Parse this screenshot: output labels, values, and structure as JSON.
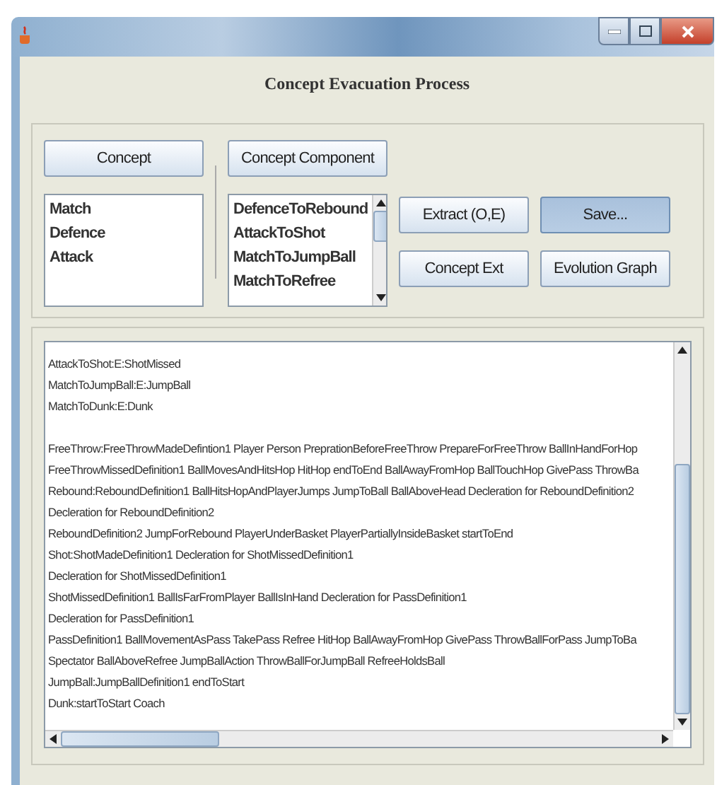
{
  "heading": "Concept Evacuation Process",
  "concept_panel": {
    "button": "Concept",
    "items": [
      "Match",
      "Defence",
      "Attack"
    ]
  },
  "component_panel": {
    "button": "Concept Component",
    "items": [
      "DefenceToRebound",
      "AttackToShot",
      "MatchToJumpBall",
      "MatchToRefree"
    ]
  },
  "actions": [
    {
      "label": "Extract (O,E)",
      "selected": false
    },
    {
      "label": "Save...",
      "selected": true
    },
    {
      "label": "Concept Ext",
      "selected": false
    },
    {
      "label": "Evolution Graph",
      "selected": false
    }
  ],
  "output": {
    "paragraphs": [
      [
        "AttackToShot:E:ShotMissed",
        "MatchToJumpBall:E:JumpBall",
        "MatchToDunk:E:Dunk"
      ],
      [
        "FreeThrow:FreeThrowMadeDefintion1 Player Person PreprationBeforeFreeThrow PrepareForFreeThrow BallInHandForHop",
        "FreeThrowMissedDefinition1 BallMovesAndHitsHop HitHop endToEnd BallAwayFromHop BallTouchHop GivePass ThrowBa",
        "Rebound:ReboundDefinition1 BallHitsHopAndPlayerJumps JumpToBall BallAboveHead Decleration for ReboundDefinition2",
        "Decleration for ReboundDefinition2",
        "ReboundDefinition2 JumpForRebound PlayerUnderBasket PlayerPartiallyInsideBasket startToEnd",
        "Shot:ShotMadeDefinition1 Decleration for ShotMissedDefinition1",
        "Decleration for ShotMissedDefinition1",
        "ShotMissedDefinition1 BallIsFarFromPlayer BallIsInHand Decleration for PassDefinition1",
        "Decleration for PassDefinition1",
        "PassDefinition1 BallMovementAsPass TakePass Refree HitHop BallAwayFromHop GivePass ThrowBallForPass JumpToBa",
        "Spectator BallAboveRefree JumpBallAction ThrowBallForJumpBall RefreeHoldsBall",
        "JumpBall:JumpBallDefinition1 endToStart",
        "Dunk:startToStart Coach"
      ]
    ]
  }
}
